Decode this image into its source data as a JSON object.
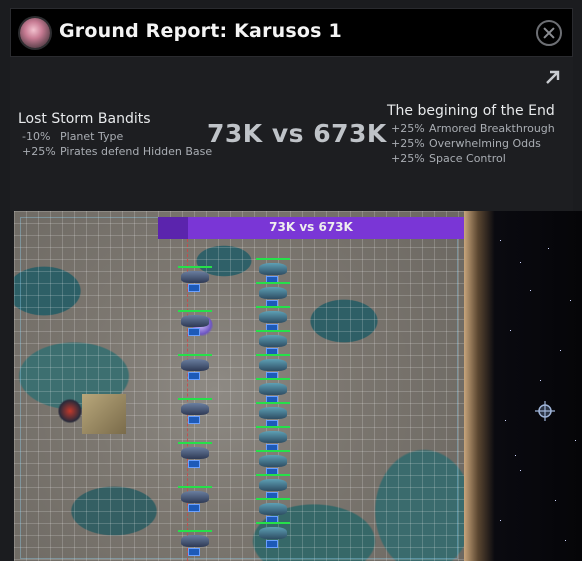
{
  "window": {
    "title": "Ground Report: Karusos 1"
  },
  "report": {
    "left": {
      "name": "Lost Storm Bandits",
      "modifiers": [
        {
          "pct": "-10%",
          "label": "Planet Type"
        },
        {
          "pct": "+25%",
          "label": "Pirates defend Hidden Base"
        }
      ]
    },
    "score": "73K vs 673K",
    "right": {
      "name": "The begining of the End",
      "modifiers": [
        {
          "pct": "+25%",
          "label": "Armored Breakthrough"
        },
        {
          "pct": "+25%",
          "label": "Overwhelming Odds"
        },
        {
          "pct": "+25%",
          "label": "Space Control"
        }
      ]
    }
  },
  "battle": {
    "strength_bar_label": "73K vs 673K",
    "left_strength": 73,
    "right_strength": 673,
    "colors": {
      "bar": "#7a36d6",
      "bar_left": "#5b24ad",
      "health": "#26e04a"
    }
  }
}
